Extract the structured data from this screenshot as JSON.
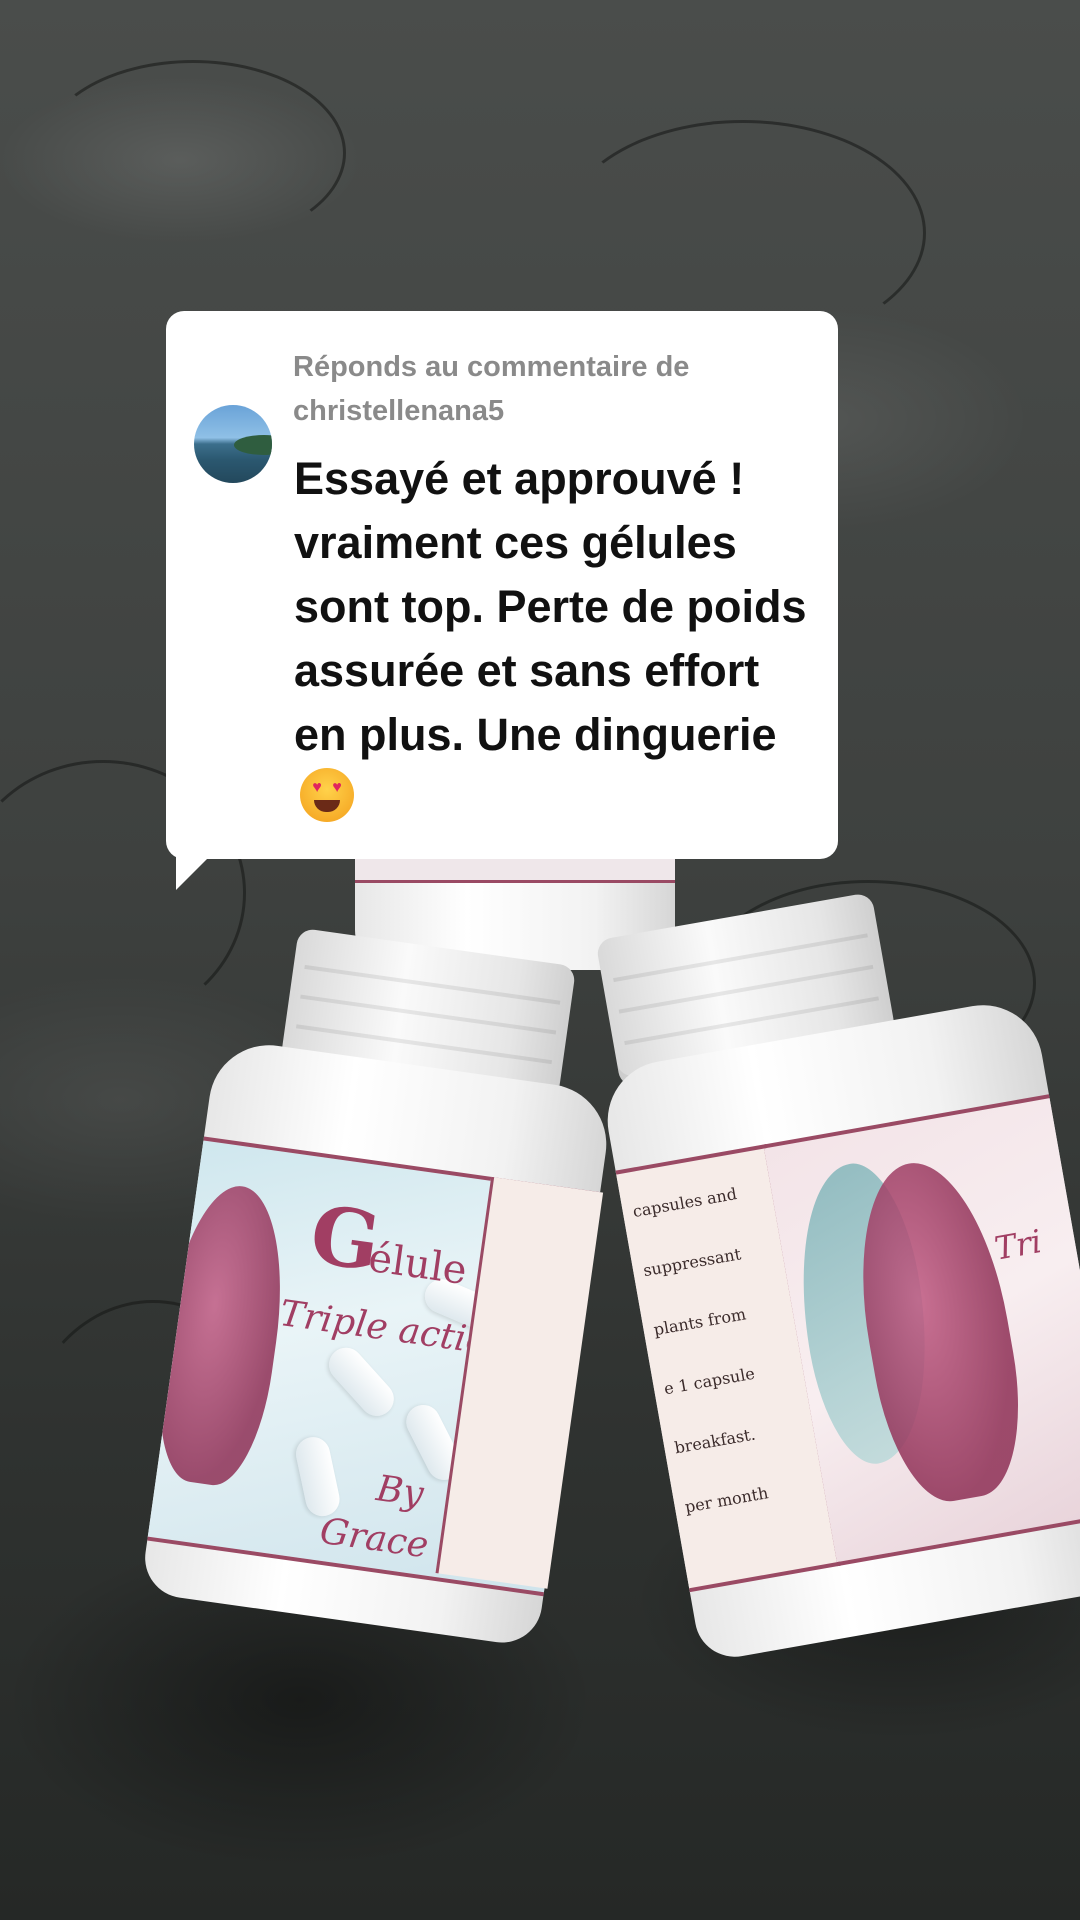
{
  "comment": {
    "reply_label": "Réponds au commentaire de christellenana5",
    "text": "Essayé et approuvé ! vraiment ces gélules sont top. Perte de poids assurée et sans effort en plus. Une dinguerie",
    "emoji": "smiling-face-with-heart-eyes-icon"
  },
  "product_left": {
    "brand_letter": "G",
    "line1": "élule",
    "line2": "Triple action",
    "by": "By",
    "maker": "Grace"
  },
  "product_right": {
    "side_lines": [
      "capsules and",
      "suppressant",
      "plants from",
      "e 1 capsule",
      "breakfast.",
      "per month"
    ],
    "name_partial": "Tri"
  },
  "colors": {
    "bubble_bg": "#ffffff",
    "reply_text": "#8a8a8a",
    "comment_text": "#111111",
    "label_accent": "#9a4a64"
  }
}
